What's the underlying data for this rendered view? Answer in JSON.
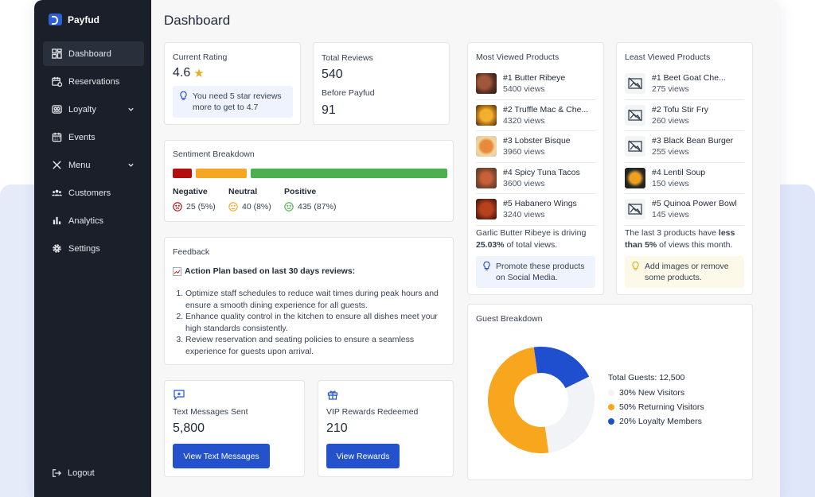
{
  "brand": {
    "name": "Payfud"
  },
  "sidebar": {
    "items": [
      {
        "label": "Dashboard"
      },
      {
        "label": "Reservations"
      },
      {
        "label": "Loyalty"
      },
      {
        "label": "Events"
      },
      {
        "label": "Menu"
      },
      {
        "label": "Customers"
      },
      {
        "label": "Analytics"
      },
      {
        "label": "Settings"
      }
    ],
    "logout": "Logout"
  },
  "page": {
    "title": "Dashboard"
  },
  "rating": {
    "title": "Current Rating",
    "value": "4.6",
    "tip": "You need 5 star reviews more to get to 4.7"
  },
  "reviews": {
    "title": "Total Reviews",
    "value": "540",
    "before_label": "Before Payfud",
    "before_value": "91"
  },
  "sentiment": {
    "title": "Sentiment Breakdown",
    "negative": {
      "label": "Negative",
      "value": "25 (5%)",
      "pct": 5,
      "color": "#b40f0f"
    },
    "neutral": {
      "label": "Neutral",
      "value": "40 (8%)",
      "pct": 8,
      "color": "#f5a623"
    },
    "positive": {
      "label": "Positive",
      "value": "435 (87%)",
      "pct": 87,
      "color": "#4caf50"
    }
  },
  "feedback": {
    "title": "Feedback",
    "plan_heading": "Action Plan based on last 30 days reviews:",
    "items": [
      "Optimize staff schedules to reduce wait times during peak hours and ensure a smooth dining experience for all guests.",
      "Enhance quality control in the kitchen to ensure all dishes meet your high standards consistently.",
      "Review reservation and seating policies to ensure a seamless experience for guests upon arrival."
    ]
  },
  "messages": {
    "title": "Text Messages Sent",
    "value": "5,800",
    "button": "View Text Messages"
  },
  "rewards": {
    "title": "VIP Rewards Redeemed",
    "value": "210",
    "button": "View Rewards"
  },
  "most_viewed": {
    "title": "Most Viewed Products",
    "items": [
      {
        "name": "#1 Butter Ribeye",
        "views": "5400 views"
      },
      {
        "name": "#2 Truffle Mac & Che...",
        "views": "4320 views"
      },
      {
        "name": "#3 Lobster Bisque",
        "views": "3960 views"
      },
      {
        "name": "#4 Spicy Tuna Tacos",
        "views": "3600 views"
      },
      {
        "name": "#5 Habanero Wings",
        "views": "3240 views"
      }
    ],
    "note_product": "Garlic Butter Ribeye",
    "note_mid": " is driving ",
    "note_pct": "25.03%",
    "note_end": " of total views.",
    "tip": "Promote these products on Social Media."
  },
  "least_viewed": {
    "title": "Least Viewed Products",
    "items": [
      {
        "name": "#1 Beet Goat Che...",
        "views": "275 views"
      },
      {
        "name": "#2 Tofu Stir Fry",
        "views": "260 views"
      },
      {
        "name": "#3 Black Bean Burger",
        "views": "255 views"
      },
      {
        "name": "#4 Lentil Soup",
        "views": "150 views"
      },
      {
        "name": "#5 Quinoa Power Bowl",
        "views": "145 views"
      }
    ],
    "note_start": "The last 3 products have ",
    "note_bold": "less than 5%",
    "note_end": " of views this month.",
    "tip": "Add images or remove some products."
  },
  "guests": {
    "title": "Guest Breakdown",
    "total": "Total Guests: 12,500",
    "segments": [
      {
        "label": "30% New Visitors",
        "pct": 30,
        "color": "#f1f3f6"
      },
      {
        "label": "50% Returning Visitors",
        "pct": 50,
        "color": "#f8a61e"
      },
      {
        "label": "20% Loyalty Members",
        "pct": 20,
        "color": "#1f4fcf"
      }
    ]
  }
}
